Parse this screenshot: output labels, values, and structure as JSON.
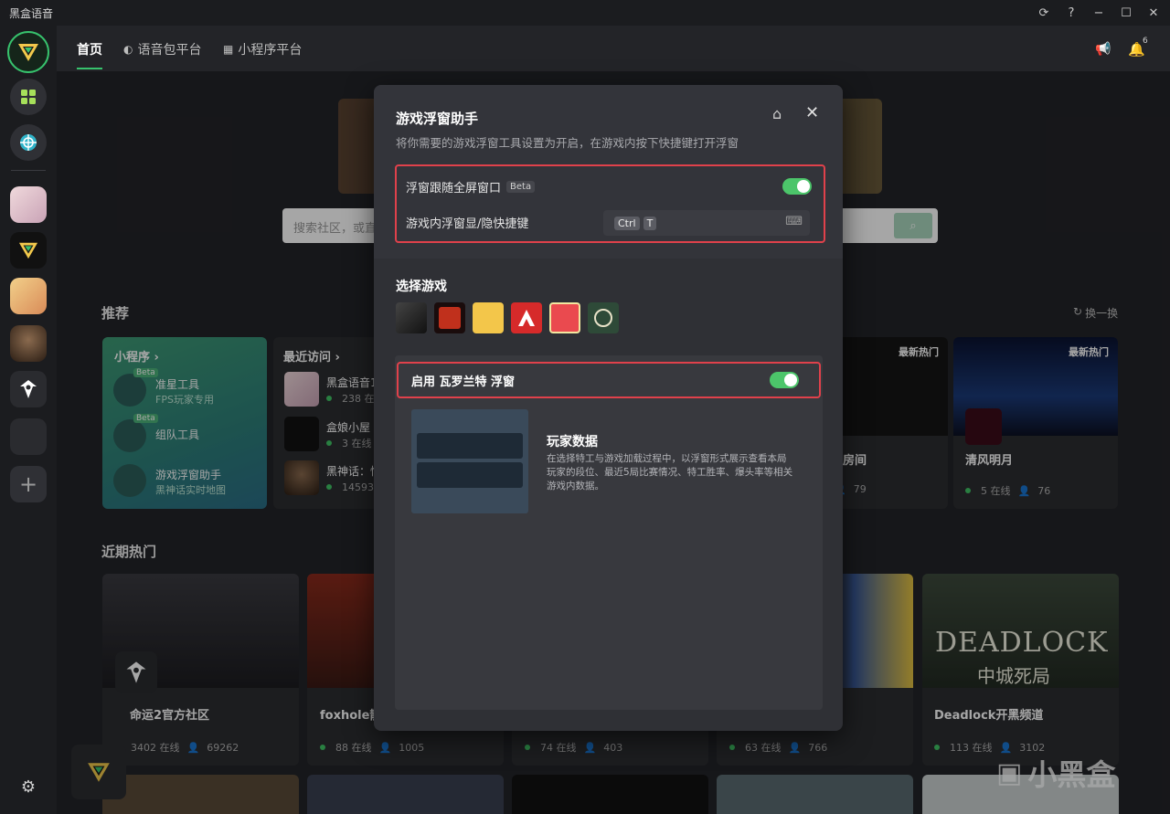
{
  "app": {
    "title": "黑盒语音"
  },
  "window_controls": [
    "refresh-icon",
    "help-icon",
    "minimize-icon",
    "maximize-icon",
    "close-icon"
  ],
  "nav": {
    "tabs": [
      {
        "label": "首页",
        "active": true
      },
      {
        "label": "语音包平台",
        "icon": "voice-pack-icon"
      },
      {
        "label": "小程序平台",
        "icon": "apps-grid-icon"
      }
    ],
    "notification_count": "6"
  },
  "search": {
    "placeholder": "搜索社区，或直"
  },
  "recommend": {
    "title": "推荐",
    "refresh_label": "换一换",
    "miniprogram": {
      "header": "小程序 ›",
      "items": [
        {
          "name": "准星工具",
          "desc": "FPS玩家专用",
          "badge": "Beta"
        },
        {
          "name": "组队工具",
          "desc": "",
          "badge": "Beta"
        },
        {
          "name": "游戏浮窗助手",
          "desc": "黑神话实时地图"
        }
      ]
    },
    "recent": {
      "header": "最近访问 ›",
      "items": [
        {
          "name": "黑盒语音1",
          "online": "238 在线"
        },
        {
          "name": "盒娘小屋",
          "online": "3 在线"
        },
        {
          "name": "黑神话：悟",
          "online": "14593 在"
        }
      ]
    },
    "hot_cards": [
      {
        "tag": "最新热门",
        "name": "房间",
        "stat": "79"
      },
      {
        "tag": "最新热门",
        "name": "清风明月",
        "online": "5 在线",
        "members": "76"
      }
    ]
  },
  "trending": {
    "title": "近期热门",
    "cards": [
      {
        "name": "命运2官方社区",
        "online": "3402 在线",
        "members": "69262"
      },
      {
        "name": "foxhole散",
        "online": "88 在线",
        "members": "1005"
      },
      {
        "name": "",
        "online": "74 在线",
        "members": "403"
      },
      {
        "name": "",
        "online": "63 在线",
        "members": "766"
      },
      {
        "name": "Deadlock开黑频道",
        "online": "113 在线",
        "members": "3102",
        "banner_text": "DEADLOCK",
        "banner_sub": "中城死局"
      }
    ]
  },
  "modal": {
    "title": "游戏浮窗助手",
    "subtitle": "将你需要的游戏浮窗工具设置为开启，在游戏内按下快捷键打开浮窗",
    "follow_fullscreen": {
      "label": "浮窗跟随全屏窗口",
      "badge": "Beta",
      "enabled": true
    },
    "hotkey": {
      "label": "游戏内浮窗显/隐快捷键",
      "keys": [
        "Ctrl",
        "T"
      ]
    },
    "select_game": {
      "title": "选择游戏"
    },
    "enable": {
      "label": "启用 瓦罗兰特 浮窗",
      "enabled": true
    },
    "feature": {
      "title": "玩家数据",
      "desc": "在选择特工与游戏加载过程中，以浮窗形式展示查看本局玩家的段位、最近5局比赛情况、特工胜率、爆头率等相关游戏内数据。"
    }
  },
  "watermark": "小黑盒",
  "colors": {
    "accent": "#37c26d",
    "highlight_border": "#e0414b",
    "toggle_on": "#4cc56a"
  }
}
